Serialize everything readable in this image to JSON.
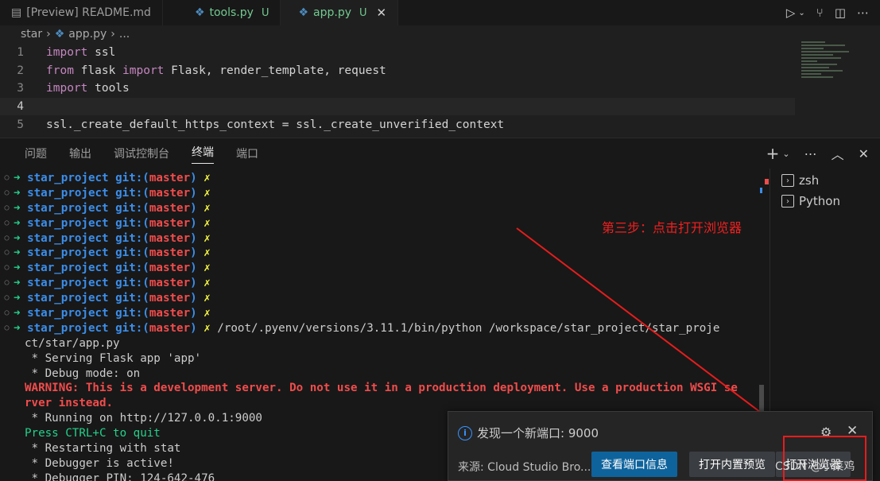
{
  "tabs": [
    {
      "label": "[Preview] README.md",
      "icon": "preview-icon",
      "modified": ""
    },
    {
      "label": "tools.py",
      "icon": "python-icon",
      "modified": "U"
    },
    {
      "label": "app.py",
      "icon": "python-icon",
      "modified": "U",
      "active": true
    }
  ],
  "breadcrumb": {
    "folder": "star",
    "file": "app.py",
    "more": "..."
  },
  "editor": {
    "lines": [
      {
        "num": "1",
        "kw": "import",
        "rest": " ssl"
      },
      {
        "num": "2",
        "kw": "from",
        "mid": " flask ",
        "kw2": "import",
        "rest": " Flask, render_template, request"
      },
      {
        "num": "3",
        "kw": "import",
        "rest": " tools"
      },
      {
        "num": "4",
        "kw": "",
        "rest": ""
      },
      {
        "num": "5",
        "kw": "",
        "rest": "ssl._create_default_https_context = ssl._create_unverified_context"
      }
    ]
  },
  "panel": {
    "tabs": [
      "问题",
      "输出",
      "调试控制台",
      "终端",
      "端口"
    ],
    "active_tab": "终端"
  },
  "terminal": {
    "prompt_arrow": "➜",
    "project": "star_project",
    "git": "git:(",
    "branch": "master",
    "git_close": ")",
    "dirty": "✗",
    "command": "/root/.pyenv/versions/3.11.1/bin/python /workspace/star_project/star_proje",
    "command_cont": "ct/star/app.py",
    "output": [
      {
        "text": " * Serving Flask app 'app'",
        "style": "plain"
      },
      {
        "text": " * Debug mode: on",
        "style": "plain"
      },
      {
        "text": "WARNING: This is a development server. Do not use it in a production deployment. Use a production WSGI se",
        "style": "warn"
      },
      {
        "text": "rver instead.",
        "style": "warn"
      },
      {
        "text": " * Running on http://127.0.0.1:9000",
        "style": "plain"
      },
      {
        "text": "Press CTRL+C to quit",
        "style": "ok"
      },
      {
        "text": " * Restarting with stat",
        "style": "plain"
      },
      {
        "text": " * Debugger is active!",
        "style": "plain"
      },
      {
        "text": " * Debugger PIN: 124-642-476",
        "style": "plain"
      }
    ]
  },
  "terminal_list": [
    "zsh",
    "Python"
  ],
  "annotation": "第三步：点击打开浏览器",
  "notification": {
    "message": "发现一个新端口: 9000",
    "source": "来源: Cloud Studio Bro...",
    "btn_primary": "查看端口信息",
    "btn_preview": "打开内置预览",
    "btn_open": "打开浏览器"
  },
  "watermark": "CSDN @小菜鸡"
}
